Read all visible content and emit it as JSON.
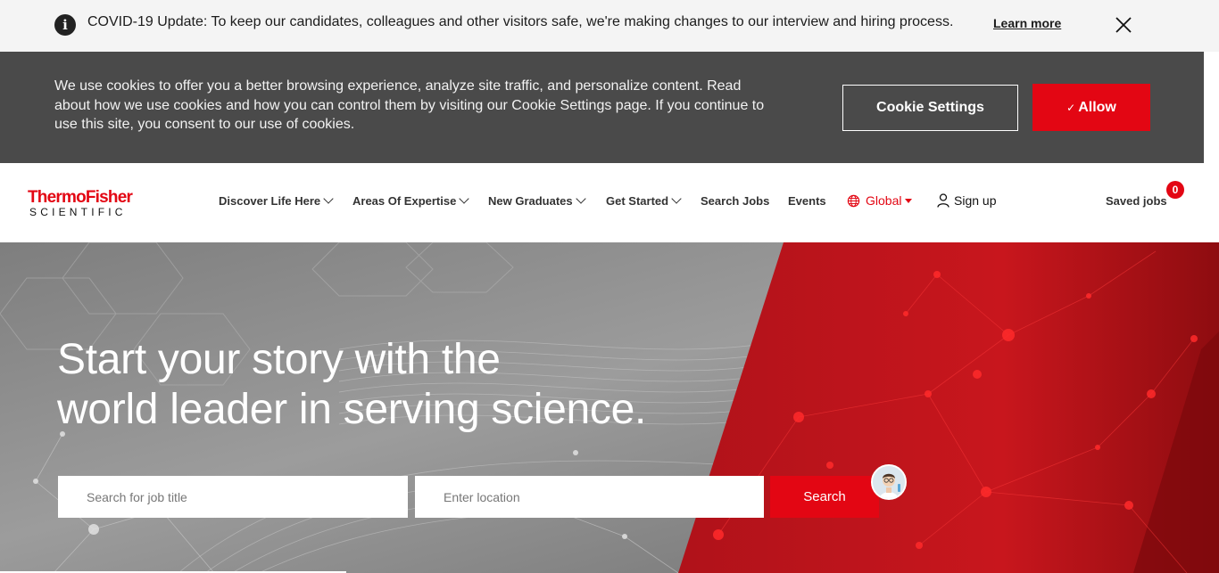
{
  "covid_banner": {
    "message": "COVID-19 Update: To keep our candidates, colleagues and other visitors safe, we're making changes to our interview and hiring process.",
    "learn_more": "Learn more",
    "info_icon": "i"
  },
  "cookie_bar": {
    "text": "We use cookies to offer you a better browsing experience, analyze site traffic, and personalize content. Read about how we use cookies and how you can control them by visiting our Cookie Settings page. If you continue to use this site, you consent to our use of cookies.",
    "settings_label": "Cookie Settings",
    "allow_check": "✓",
    "allow_label": "Allow"
  },
  "logo": {
    "line1": "ThermoFisher",
    "line2": "SCIENTIFIC"
  },
  "nav": {
    "items": [
      {
        "label": "Discover Life Here"
      },
      {
        "label": "Areas Of Expertise"
      },
      {
        "label": "New Graduates"
      },
      {
        "label": "Get Started"
      },
      {
        "label": "Search Jobs"
      },
      {
        "label": "Events"
      }
    ],
    "global_label": "Global",
    "signup_label": "Sign up",
    "saved_jobs_label": "Saved jobs",
    "saved_jobs_count": "0"
  },
  "hero": {
    "headline_line1": "Start your story with the",
    "headline_line2": "world leader in serving science.",
    "job_placeholder": "Search for job title",
    "location_placeholder": "Enter location",
    "search_label": "Search"
  },
  "colors": {
    "brand_red": "#e30613",
    "cookie_bg": "#4a4a4a",
    "banner_bg": "#f4f4f4"
  },
  "icons": [
    "info-icon",
    "close-icon",
    "globe-icon",
    "user-icon",
    "chevron-down-icon",
    "checkmark-icon",
    "chatbot-avatar-icon"
  ]
}
